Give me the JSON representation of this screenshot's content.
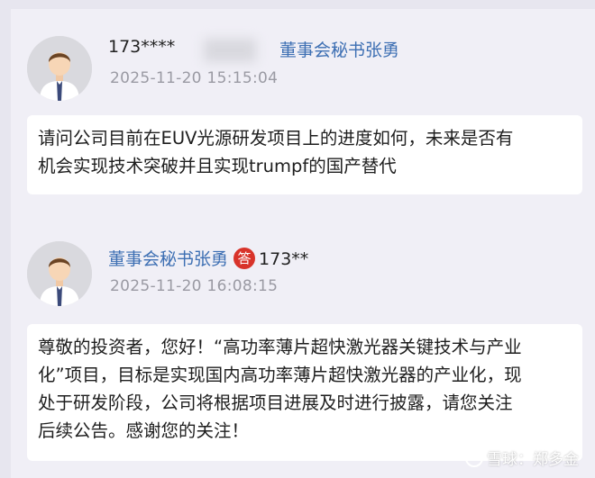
{
  "question": {
    "user": "173****",
    "mention": "董事会秘书张勇",
    "time": "2025-11-20 15:15:04",
    "line1": "请问公司目前在EUV光源研发项目上的进度如何，未来是否有",
    "line2": "机会实现技术突破并且实现trumpf的国产替代"
  },
  "answer": {
    "user": "董事会秘书张勇",
    "badge": "答",
    "reply_to": "173**",
    "time": "2025-11-20 16:08:15",
    "line1": "尊敬的投资者，您好！“高功率薄片超快激光器关键技术与产业",
    "line2": "化”项目，目标是实现国内高功率薄片超快激光器的产业化，现",
    "line3": "处于研发阶段，公司将根据项目进展及时进行披露，请您关注",
    "line4": "后续公告。感谢您的关注！"
  },
  "watermark": {
    "text": "雪球：郑多金"
  },
  "icons": {
    "avatar": "default-user-avatar-icon",
    "logo": "xueqiu-logo-icon"
  }
}
